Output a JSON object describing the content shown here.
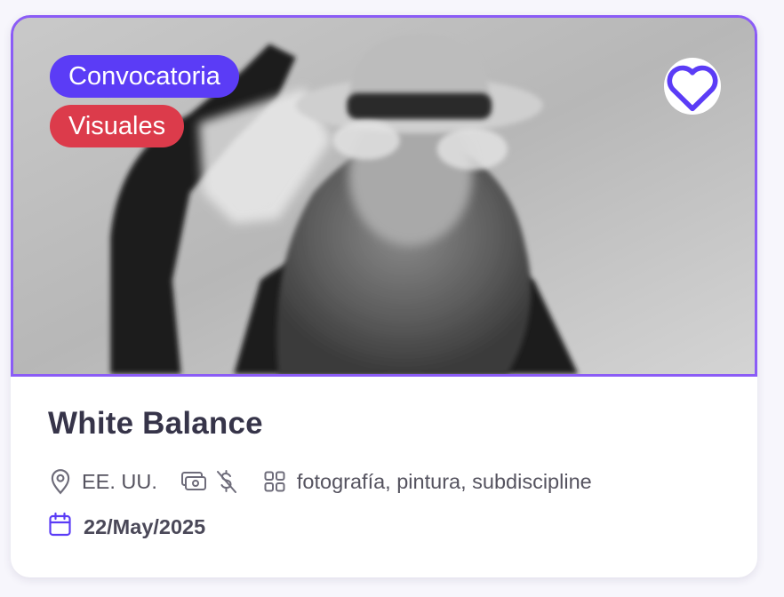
{
  "card": {
    "badges": [
      {
        "label": "Convocatoria",
        "color": "#5b3cf6"
      },
      {
        "label": "Visuales",
        "color": "#dc3b4b"
      }
    ],
    "favorite": {
      "icon": "heart-outline-icon"
    },
    "title": "White Balance",
    "location": "EE. UU.",
    "location_icon": "map-pin-icon",
    "price_icons": [
      "cash-icon",
      "no-fee-icon"
    ],
    "category_icon": "grid-icon",
    "disciplines": "fotografía, pintura, subdiscipline",
    "date_icon": "calendar-icon",
    "date": "22/May/2025"
  },
  "colors": {
    "accent": "#8b5cf6",
    "badge_primary": "#5b3cf6",
    "badge_secondary": "#dc3b4b",
    "title": "#363449"
  }
}
